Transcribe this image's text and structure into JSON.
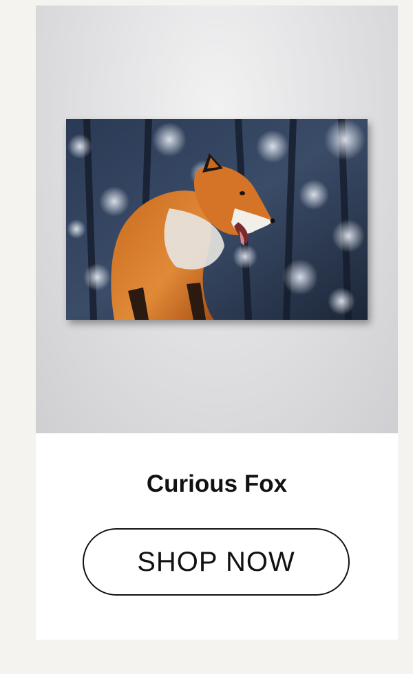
{
  "product": {
    "title": "Curious Fox",
    "image_subject": "red fox in snowy forest canvas print",
    "shop_button_label": "SHOP NOW"
  },
  "colors": {
    "page_background": "#f4f3ef",
    "card_background": "#ffffff",
    "text": "#111111",
    "fox_orange": "#d2691e"
  }
}
